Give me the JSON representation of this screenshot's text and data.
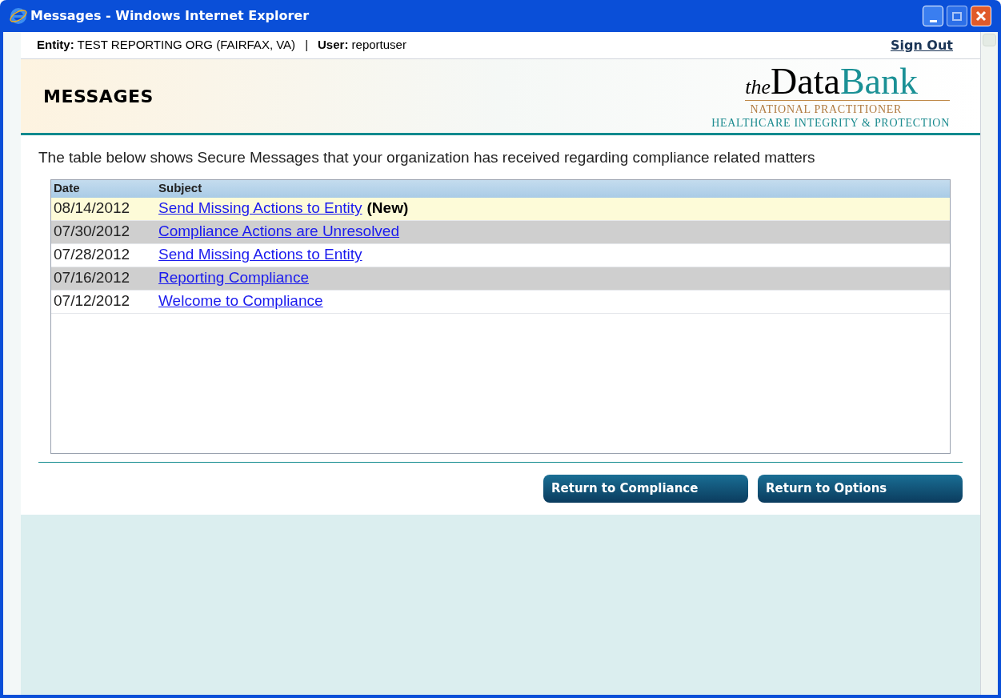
{
  "window": {
    "title": "Messages - Windows Internet Explorer"
  },
  "header": {
    "entity_label": "Entity:",
    "entity": "TEST REPORTING ORG (FAIRFAX, VA)",
    "separator": "|",
    "user_label": "User:",
    "user": "reportuser",
    "sign_out": "Sign Out"
  },
  "page_title": "MESSAGES",
  "logo": {
    "prefix": "the",
    "word_1": "Data",
    "word_2": "Bank",
    "line_1": "NATIONAL PRACTITIONER",
    "line_2": "HEALTHCARE INTEGRITY & PROTECTION"
  },
  "intro": "The table below shows Secure Messages that your organization has received regarding compliance related matters",
  "table": {
    "columns": [
      "Date",
      "Subject"
    ],
    "rows": [
      {
        "date": "08/14/2012",
        "subject": "Send Missing Actions to Entity",
        "badge": "(New)",
        "highlighted": true
      },
      {
        "date": "07/30/2012",
        "subject": "Compliance Actions are Unresolved",
        "highlighted": false
      },
      {
        "date": "07/28/2012",
        "subject": "Send Missing Actions to Entity",
        "highlighted": false
      },
      {
        "date": "07/16/2012",
        "subject": "Reporting Compliance",
        "highlighted": false
      },
      {
        "date": "07/12/2012",
        "subject": "Welcome to Compliance",
        "highlighted": false
      }
    ]
  },
  "buttons": [
    "Return to Compliance",
    "Return to Options"
  ]
}
